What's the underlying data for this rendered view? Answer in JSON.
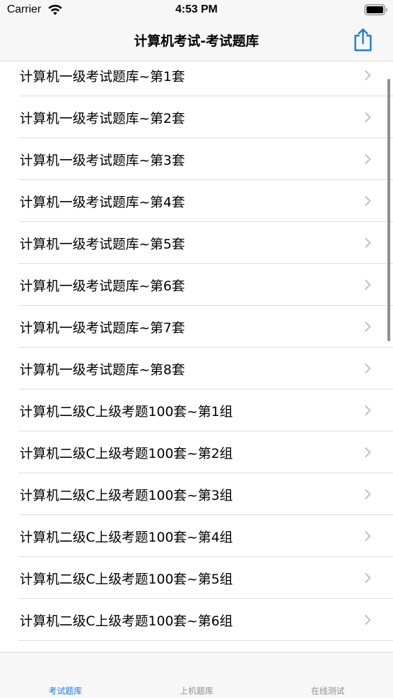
{
  "status_bar": {
    "carrier": "Carrier",
    "time": "4:53 PM"
  },
  "nav": {
    "title": "计算机考试-考试题库",
    "share_icon": "share-icon",
    "accent_color": "#1a7ae8"
  },
  "list": {
    "items": [
      {
        "label": "计算机一级考试题库~第1套"
      },
      {
        "label": "计算机一级考试题库~第2套"
      },
      {
        "label": "计算机一级考试题库~第3套"
      },
      {
        "label": "计算机一级考试题库~第4套"
      },
      {
        "label": "计算机一级考试题库~第5套"
      },
      {
        "label": "计算机一级考试题库~第6套"
      },
      {
        "label": "计算机一级考试题库~第7套"
      },
      {
        "label": "计算机一级考试题库~第8套"
      },
      {
        "label": "计算机二级C上级考题100套~第1组"
      },
      {
        "label": "计算机二级C上级考题100套~第2组"
      },
      {
        "label": "计算机二级C上级考题100套~第3组"
      },
      {
        "label": "计算机二级C上级考题100套~第4组"
      },
      {
        "label": "计算机二级C上级考题100套~第5组"
      },
      {
        "label": "计算机二级C上级考题100套~第6组"
      }
    ]
  },
  "tabs": [
    {
      "label": "考试题库",
      "active": true
    },
    {
      "label": "上机题库",
      "active": false
    },
    {
      "label": "在线测试",
      "active": false
    }
  ]
}
